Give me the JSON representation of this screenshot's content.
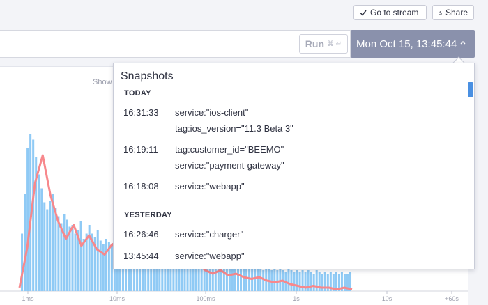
{
  "toolbar": {
    "go_to_stream_label": "Go to stream",
    "share_label": "Share"
  },
  "query": {
    "run_label": "Run",
    "run_shortcut": "⌘ ↵",
    "time_label": "Mon Oct 15, 13:45:44"
  },
  "chart": {
    "show_label": "Show"
  },
  "chart_data": {
    "type": "bar",
    "x_scale": "log",
    "x_tick_labels": [
      "1ms",
      "10ms",
      "100ms",
      "1s",
      "10s",
      "+60s"
    ],
    "colors": {
      "bars": "#8fcaf5",
      "line": "#f7888c"
    },
    "bin_heights": [
      0.0,
      0.0,
      0.33,
      0.56,
      0.82,
      0.9,
      0.87,
      0.77,
      0.67,
      0.59,
      0.51,
      0.47,
      0.52,
      0.56,
      0.48,
      0.43,
      0.39,
      0.44,
      0.41,
      0.37,
      0.38,
      0.33,
      0.35,
      0.4,
      0.3,
      0.33,
      0.38,
      0.33,
      0.31,
      0.35,
      0.29,
      0.27,
      0.3,
      0.28,
      0.26,
      0.3,
      0.27,
      0.25,
      0.28,
      0.24,
      0.26,
      0.22,
      0.25,
      0.23,
      0.21,
      0.24,
      0.2,
      0.22,
      0.21,
      0.19,
      0.2,
      0.18,
      0.2,
      0.19,
      0.17,
      0.2,
      0.18,
      0.17,
      0.19,
      0.17,
      0.16,
      0.18,
      0.17,
      0.16,
      0.17,
      0.16,
      0.15,
      0.17,
      0.16,
      0.15,
      0.16,
      0.15,
      0.14,
      0.16,
      0.15,
      0.14,
      0.15,
      0.14,
      0.15,
      0.14,
      0.13,
      0.15,
      0.14,
      0.13,
      0.14,
      0.13,
      0.14,
      0.13,
      0.12,
      0.14,
      0.13,
      0.12,
      0.13,
      0.12,
      0.13,
      0.12,
      0.11,
      0.13,
      0.12,
      0.11,
      0.12,
      0.11,
      0.12,
      0.11,
      0.12,
      0.11,
      0.1,
      0.12,
      0.11,
      0.1,
      0.11,
      0.1,
      0.11,
      0.1,
      0.11,
      0.1,
      0.11,
      0.1,
      0.1,
      0.11
    ],
    "line": [
      0.02,
      0.25,
      0.62,
      0.78,
      0.55,
      0.4,
      0.3,
      0.38,
      0.26,
      0.32,
      0.24,
      0.21,
      0.27,
      0.22,
      0.2,
      0.18,
      0.22,
      0.17,
      0.2,
      0.16,
      0.18,
      0.15,
      0.14,
      0.16,
      0.12,
      0.1,
      0.12,
      0.09,
      0.1,
      0.08,
      0.07,
      0.08,
      0.06,
      0.05,
      0.06,
      0.04,
      0.03,
      0.02,
      0.03,
      0.02,
      0.02,
      0.01,
      0.02,
      0.01
    ]
  },
  "snapshots": {
    "title": "Snapshots",
    "sections": [
      {
        "label": "TODAY",
        "items": [
          {
            "time": "16:31:33",
            "lines": [
              "service:\"ios-client\"",
              "tag:ios_version=\"11.3 Beta 3\""
            ]
          },
          {
            "time": "16:19:11",
            "lines": [
              "tag:customer_id=\"BEEMO\"",
              "service:\"payment-gateway\""
            ]
          },
          {
            "time": "16:18:08",
            "lines": [
              "service:\"webapp\""
            ]
          }
        ]
      },
      {
        "label": "YESTERDAY",
        "items": [
          {
            "time": "16:26:46",
            "lines": [
              "service:\"charger\""
            ]
          },
          {
            "time": "13:45:44",
            "lines": [
              "service:\"webapp\""
            ]
          }
        ]
      }
    ]
  }
}
